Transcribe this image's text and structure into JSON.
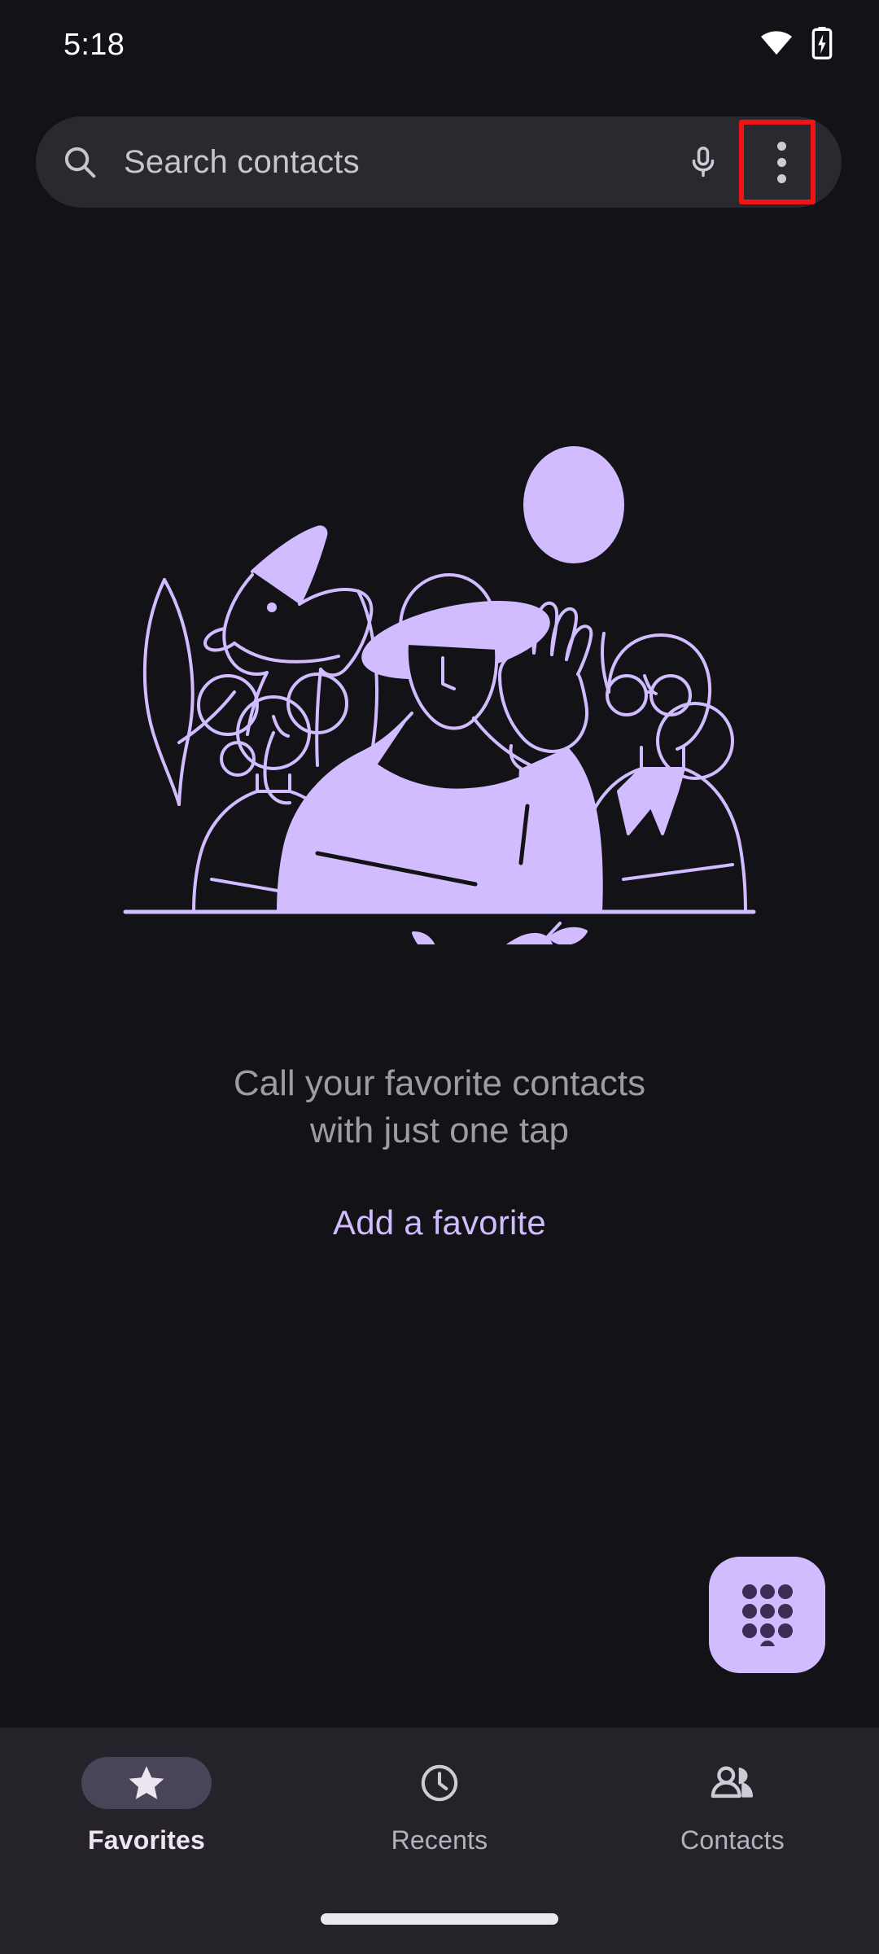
{
  "status_bar": {
    "time": "5:18",
    "icons": [
      "wifi-icon",
      "battery-charging-icon"
    ]
  },
  "search": {
    "placeholder": "Search contacts",
    "search_icon": "search-icon",
    "mic_icon": "microphone-icon",
    "overflow_icon": "more-options-icon",
    "highlighted": true,
    "highlight_color": "#F01414"
  },
  "empty_state": {
    "illustration": "people-with-dog-illustration",
    "line1": "Call your favorite contacts",
    "line2": "with just one tap",
    "action_label": "Add a favorite",
    "action_color": "#D0BCFF"
  },
  "fab": {
    "icon": "dialpad-icon",
    "background": "#D0BCFF",
    "dot_color": "#3A2E55"
  },
  "bottom_nav": {
    "items": [
      {
        "label": "Favorites",
        "icon": "star-icon",
        "active": true
      },
      {
        "label": "Recents",
        "icon": "clock-icon",
        "active": false
      },
      {
        "label": "Contacts",
        "icon": "people-icon",
        "active": false
      }
    ],
    "active_pill_color": "#4A4458",
    "background": "#252329"
  },
  "theme": {
    "background": "#131217",
    "surface": "#2B2930",
    "accent": "#D0BCFF",
    "text_primary": "#ECE6F0",
    "text_secondary": "#9E9BA3"
  },
  "system": {
    "home_indicator": "home-indicator"
  }
}
